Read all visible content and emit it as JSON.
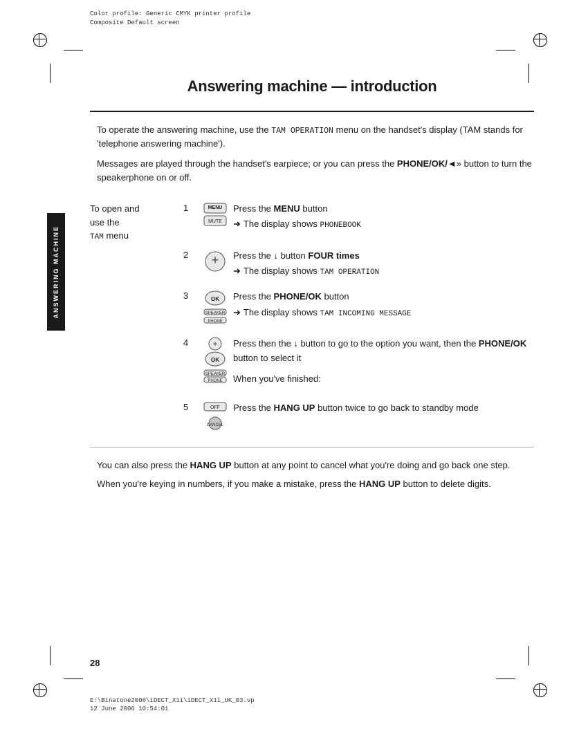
{
  "header": {
    "line1": "Color profile: Generic CMYK printer profile",
    "line2": "Composite  Default screen"
  },
  "footer": {
    "line1": "E:\\Binatone2006\\iDECT_X1i\\iDECT_X1i_UK_03.vp",
    "line2": "12 June 2006 10:54:01"
  },
  "page_number": "28",
  "side_tab_label": "ANSWERING MACHINE",
  "title": "Answering machine — introduction",
  "intro": {
    "para1_prefix": "To operate the answering machine, use the",
    "para1_mono": "TAM OPERATION",
    "para1_suffix": " menu on the handset's display (TAM stands for 'telephone answering machine').",
    "para2": "Messages are played through the handset's earpiece; or you can press the ",
    "para2_bold": "PHONE/OK/",
    "para2_speaker": "◄»",
    "para2_suffix": " button to turn the speakerphone on or off."
  },
  "instruction_section": {
    "label_line1": "To open and",
    "label_line2": "use the",
    "label_line3": "TAM",
    "label_line4": "menu",
    "steps": [
      {
        "num": "1",
        "instruction": "Press the ",
        "instruction_bold": "MENU",
        "instruction_suffix": " button",
        "sub_prefix": "The display shows",
        "sub_mono": "PHONEBOOK",
        "button_label": "MENU\nMUTE"
      },
      {
        "num": "2",
        "instruction": "Press the ↓ button ",
        "instruction_bold": "FOUR times",
        "sub_prefix": "The display shows",
        "sub_mono": "TAM OPERATION",
        "button_label": "+"
      },
      {
        "num": "3",
        "instruction": "Press the ",
        "instruction_bold": "PHONE/OK",
        "instruction_suffix": " button",
        "sub_prefix": "The display shows",
        "sub_mono": "TAM INCOMING MESSAGE",
        "button_label": "OK\nSPEAKER\nPHONE"
      },
      {
        "num": "4",
        "instruction_prefix": "Press then the ↓ button to go to the option you want, then the ",
        "instruction_bold": "PHONE/OK",
        "instruction_suffix": " button to select it",
        "when_finished": "When you've finished:",
        "button_label": "+\nOK\nSPEAKER\nPHONE"
      },
      {
        "num": "5",
        "instruction": "Press the ",
        "instruction_bold": "HANG UP",
        "instruction_suffix": " button twice to go back to standby mode",
        "button_label": "OFF\nCANCEL"
      }
    ]
  },
  "footer_paras": {
    "para1_prefix": "You can also press the ",
    "para1_bold": "HANG UP",
    "para1_suffix": " button at any point to cancel what you're doing and go back one step.",
    "para2_prefix": "When you're keying in numbers, if you make a mistake, press the ",
    "para2_bold": "HANG UP",
    "para2_suffix": " button to delete digits."
  }
}
